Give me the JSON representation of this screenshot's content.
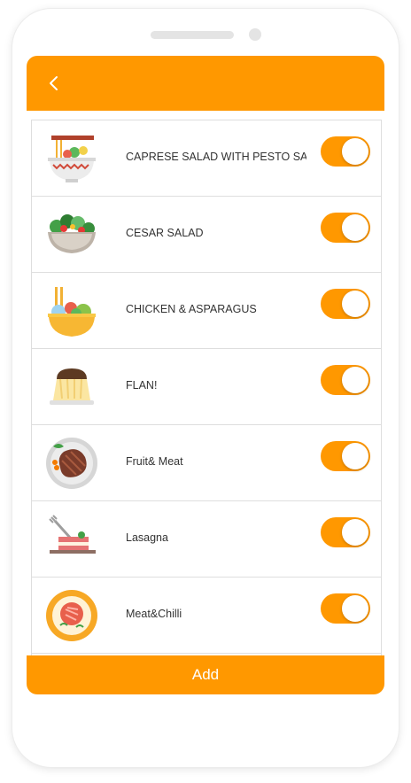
{
  "appbar": {
    "back_icon": "chevron-left-icon"
  },
  "items": [
    {
      "label": "CAPRESE SALAD WITH PESTO SAUCE",
      "icon": "noodle-bowl-icon",
      "enabled": true
    },
    {
      "label": "CESAR SALAD",
      "icon": "salad-bowl-icon",
      "enabled": true
    },
    {
      "label": "CHICKEN & ASPARAGUS",
      "icon": "rice-bowl-chopsticks-icon",
      "enabled": true
    },
    {
      "label": "FLAN!",
      "icon": "flan-dessert-icon",
      "enabled": true
    },
    {
      "label": "Fruit& Meat",
      "icon": "steak-plate-icon",
      "enabled": true
    },
    {
      "label": "Lasagna",
      "icon": "lasagna-fork-icon",
      "enabled": true
    },
    {
      "label": "Meat&Chilli",
      "icon": "meat-chilli-plate-icon",
      "enabled": true
    }
  ],
  "footer": {
    "add_label": "Add"
  },
  "colors": {
    "accent": "#ff9800",
    "text": "#333333",
    "divider": "#dedede"
  }
}
